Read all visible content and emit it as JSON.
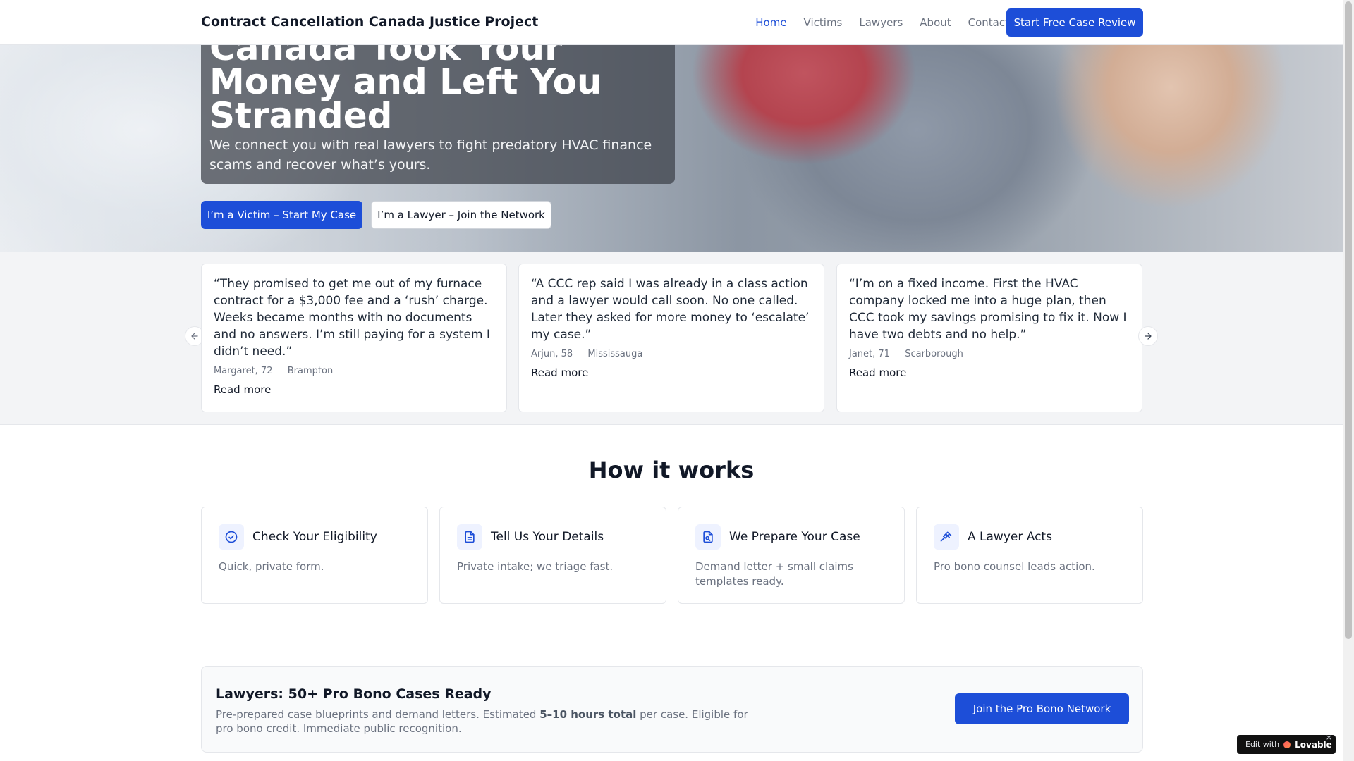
{
  "header": {
    "brand": "Contract Cancellation Canada Justice Project",
    "nav": [
      {
        "label": "Home",
        "active": true
      },
      {
        "label": "Victims"
      },
      {
        "label": "Lawyers"
      },
      {
        "label": "About"
      },
      {
        "label": "Contact"
      }
    ],
    "cta": "Start Free Case Review"
  },
  "hero": {
    "title": "Canada Took Your Money and Left You Stranded",
    "subtitle": "We connect you with real lawyers to fight predatory HVAC finance scams and recover what’s yours.",
    "victim_button": "I’m a Victim – Start My Case",
    "lawyer_button": "I’m a Lawyer – Join the Network"
  },
  "testimonials": [
    {
      "quote": "“They promised to get me out of my furnace contract for a $3,000 fee and a ‘rush’ charge. Weeks became months with no documents and no answers. I’m still paying for a system I didn’t need.”",
      "author": "Margaret, 72 — Brampton",
      "more": "Read more"
    },
    {
      "quote": "“A CCC rep said I was already in a class action and a lawyer would call soon. No one called. Later they asked for more money to ‘escalate’ my case.”",
      "author": "Arjun, 58 — Mississauga",
      "more": "Read more"
    },
    {
      "quote": "“I’m on a fixed income. First the HVAC company locked me into a huge plan, then CCC took my savings promising to fix it. Now I have two debts and no help.”",
      "author": "Janet, 71 — Scarborough",
      "more": "Read more"
    }
  ],
  "how": {
    "title": "How it works",
    "steps": [
      {
        "title": "Check Your Eligibility",
        "desc": "Quick, private form.",
        "icon": "check-circle-icon"
      },
      {
        "title": "Tell Us Your Details",
        "desc": "Private intake; we triage fast.",
        "icon": "document-icon"
      },
      {
        "title": "We Prepare Your Case",
        "desc": "Demand letter + small claims templates ready.",
        "icon": "file-search-icon"
      },
      {
        "title": "A Lawyer Acts",
        "desc": "Pro bono counsel leads action.",
        "icon": "gavel-icon"
      }
    ]
  },
  "lawyers": {
    "title": "Lawyers: 50+ Pro Bono Cases Ready",
    "desc_before": "Pre-prepared case blueprints and demand letters. Estimated ",
    "desc_bold": "5–10 hours total",
    "desc_after": " per case. Eligible for pro bono credit. Immediate public recognition.",
    "button": "Join the Pro Bono Network"
  },
  "badge": {
    "edit": "Edit with",
    "logo": "Lovable",
    "close": "×"
  },
  "colors": {
    "primary": "#1d4ed8",
    "text": "#111827",
    "muted": "#6b7280"
  }
}
